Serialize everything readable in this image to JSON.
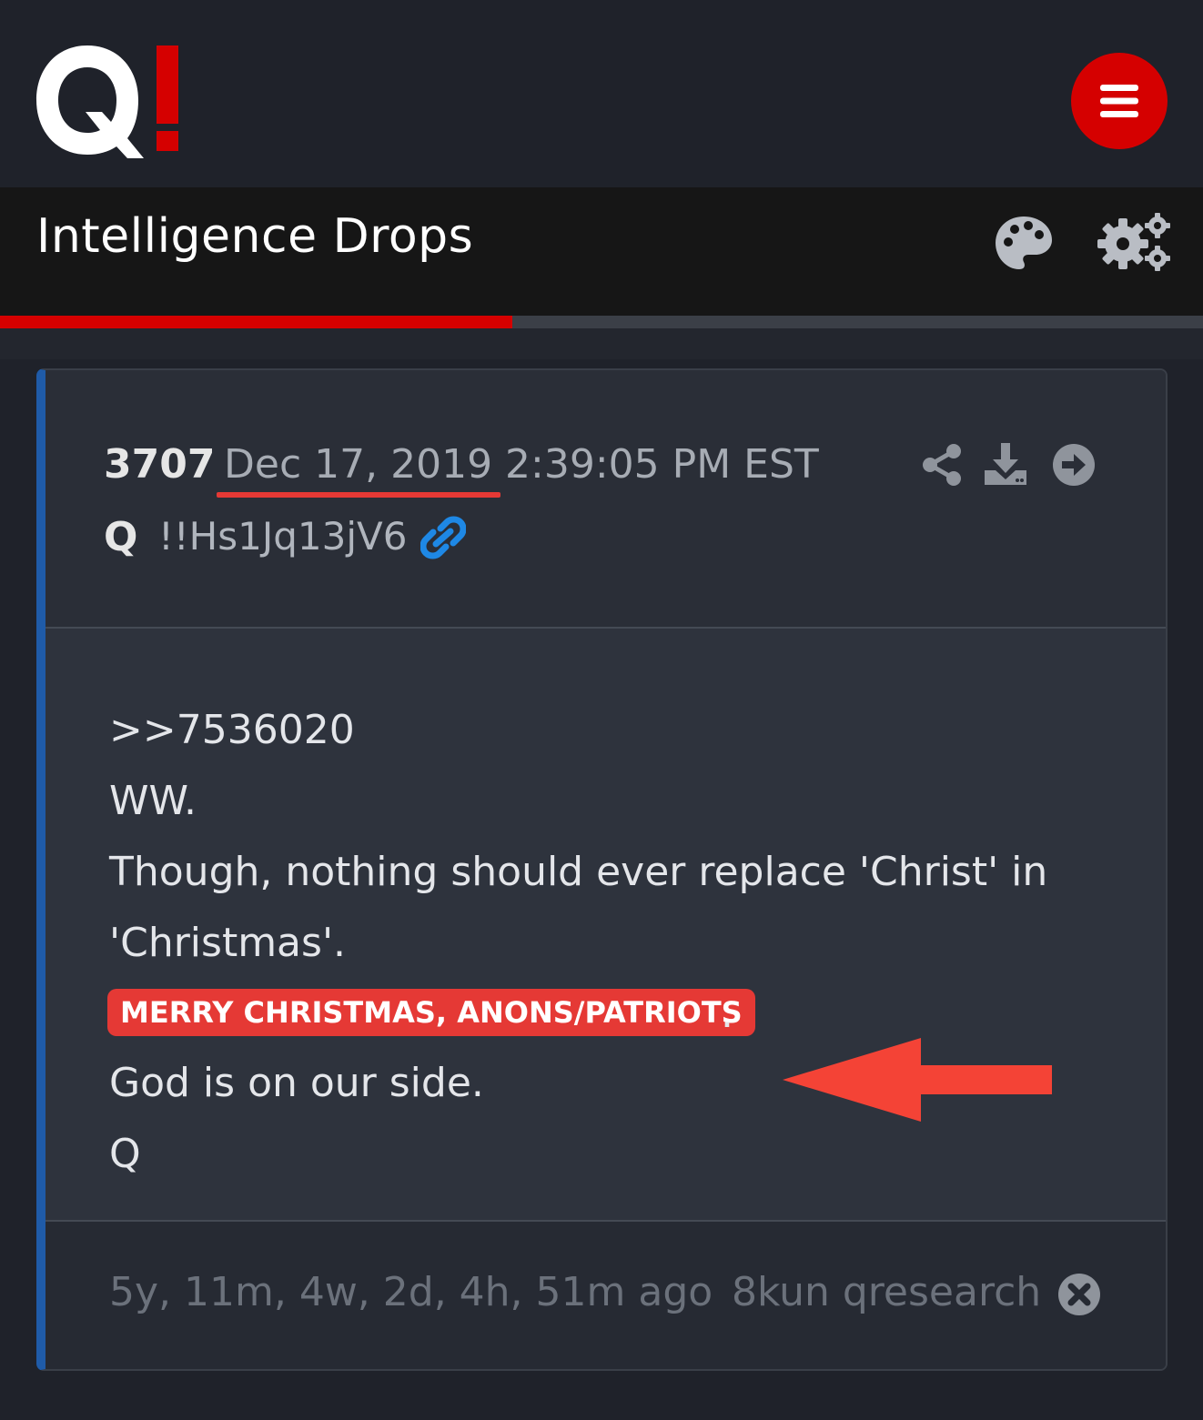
{
  "app": {
    "logo_text": "Q!"
  },
  "header": {
    "title": "Intelligence Drops",
    "progress_fraction": 0.426
  },
  "post": {
    "number": "3707",
    "date": "Dec 17, 2019 2:39:05 PM EST",
    "author": "Q",
    "tripcode": "!!Hs1Jq13jV6",
    "body": {
      "line1": ">>7536020",
      "line2": "WW.",
      "line3": "Though, nothing should ever replace 'Christ' in",
      "line4": "'Christmas'.",
      "highlight": "MERRY CHRISTMAS, ANONS/PATRIOTS",
      "highlight_suffix": ".",
      "line6": "God is on our side.",
      "line7": "Q"
    },
    "footer": {
      "ago": "5y, 11m, 4w, 2d, 4h, 51m ago",
      "source": "8kun qresearch"
    }
  },
  "colors": {
    "accent_red": "#d50000",
    "card_left_border": "#1f5ba8",
    "link_blue": "#1e88e5"
  },
  "icons": [
    "menu-icon",
    "palette-icon",
    "gears-icon",
    "link-icon",
    "share-icon",
    "download-icon",
    "arrow-circle-icon",
    "close-icon",
    "red-arrow-annotation"
  ]
}
